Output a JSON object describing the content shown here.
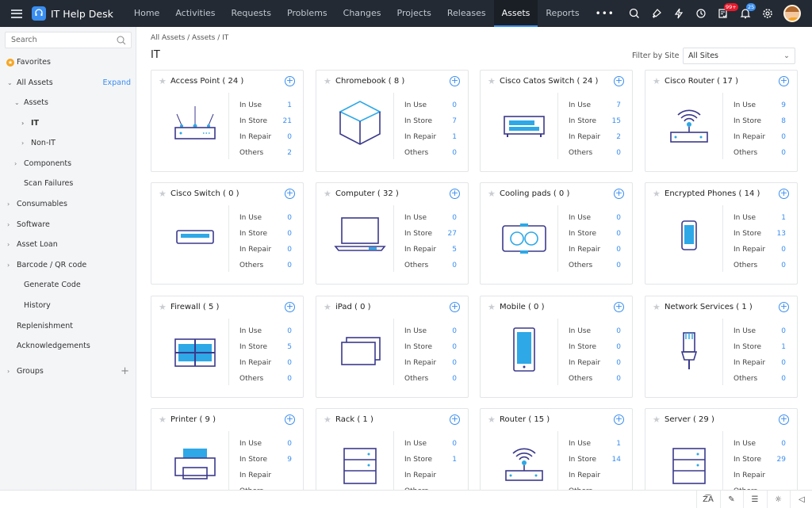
{
  "app": {
    "title": "IT Help Desk"
  },
  "nav": {
    "tabs": [
      "Home",
      "Activities",
      "Requests",
      "Problems",
      "Changes",
      "Projects",
      "Releases",
      "Assets",
      "Reports"
    ],
    "active": "Assets",
    "more": "•••",
    "icons": [
      "search-icon",
      "quick-create-icon",
      "lightning-icon",
      "history-icon",
      "tasks-icon",
      "bell-icon",
      "gear-icon"
    ],
    "tasks_badge": "99+",
    "notif_badge": "25"
  },
  "sidebar": {
    "search_placeholder": "Search",
    "favorites": "Favorites",
    "all_assets": "All Assets",
    "expand": "Expand",
    "items": [
      {
        "label": "Assets",
        "level": 1,
        "open": true
      },
      {
        "label": "IT",
        "level": 2,
        "active": true
      },
      {
        "label": "Non-IT",
        "level": 2
      },
      {
        "label": "Components",
        "level": 1
      },
      {
        "label": "Scan Failures",
        "level": 1,
        "nocaret": true
      },
      {
        "label": "Consumables",
        "level": 0
      },
      {
        "label": "Software",
        "level": 0
      },
      {
        "label": "Asset Loan",
        "level": 0
      },
      {
        "label": "Barcode / QR code",
        "level": 0
      },
      {
        "label": "Generate Code",
        "level": 1,
        "nocaret": true
      },
      {
        "label": "History",
        "level": 1,
        "nocaret": true
      },
      {
        "label": "Replenishment",
        "level": 0,
        "nocaret": true
      },
      {
        "label": "Acknowledgements",
        "level": 0,
        "nocaret": true
      }
    ],
    "groups": "Groups"
  },
  "main": {
    "breadcrumb": "All Assets  /  Assets  /  IT",
    "title": "IT",
    "filter_label": "Filter by Site",
    "filter_value": "All Sites",
    "stat_labels": [
      "In Use",
      "In Store",
      "In Repair",
      "Others"
    ],
    "cards": [
      {
        "name": "Access Point ( 24 )",
        "icon": "access-point",
        "stats": [
          "1",
          "21",
          "0",
          "2"
        ]
      },
      {
        "name": "Chromebook ( 8 )",
        "icon": "cube",
        "stats": [
          "0",
          "7",
          "1",
          "0"
        ]
      },
      {
        "name": "Cisco Catos Switch ( 24 )",
        "icon": "switch",
        "stats": [
          "7",
          "15",
          "2",
          "0"
        ]
      },
      {
        "name": "Cisco Router ( 17 )",
        "icon": "router",
        "stats": [
          "9",
          "8",
          "0",
          "0"
        ]
      },
      {
        "name": "Cisco Switch ( 0 )",
        "icon": "small-switch",
        "stats": [
          "0",
          "0",
          "0",
          "0"
        ]
      },
      {
        "name": "Computer ( 32 )",
        "icon": "laptop",
        "stats": [
          "0",
          "27",
          "5",
          "0"
        ]
      },
      {
        "name": "Cooling pads ( 0 )",
        "icon": "cooling-pad",
        "stats": [
          "0",
          "0",
          "0",
          "0"
        ]
      },
      {
        "name": "Encrypted Phones ( 14 )",
        "icon": "phone",
        "stats": [
          "1",
          "13",
          "0",
          "0"
        ]
      },
      {
        "name": "Firewall ( 5 )",
        "icon": "firewall",
        "stats": [
          "0",
          "5",
          "0",
          "0"
        ]
      },
      {
        "name": "iPad ( 0 )",
        "icon": "tablet",
        "stats": [
          "0",
          "0",
          "0",
          "0"
        ]
      },
      {
        "name": "Mobile ( 0 )",
        "icon": "mobile",
        "stats": [
          "0",
          "0",
          "0",
          "0"
        ]
      },
      {
        "name": "Network Services ( 1 )",
        "icon": "ethernet",
        "stats": [
          "0",
          "1",
          "0",
          "0"
        ]
      },
      {
        "name": "Printer ( 9 )",
        "icon": "printer",
        "stats": [
          "0",
          "9",
          "",
          ""
        ]
      },
      {
        "name": "Rack ( 1 )",
        "icon": "rack",
        "stats": [
          "0",
          "1",
          "",
          ""
        ]
      },
      {
        "name": "Router ( 15 )",
        "icon": "router",
        "stats": [
          "1",
          "14",
          "",
          ""
        ]
      },
      {
        "name": "Server ( 29 )",
        "icon": "rack",
        "stats": [
          "0",
          "29",
          "",
          ""
        ]
      }
    ]
  },
  "footer": {
    "icons": [
      "translate-icon",
      "notes-icon",
      "chat-icon",
      "tips-icon",
      "announcement-icon"
    ]
  },
  "colors": {
    "accent": "#3a8ef0",
    "navbar": "#232a33",
    "icon_dark": "#3b3a8c",
    "icon_light": "#2ea8e6"
  }
}
